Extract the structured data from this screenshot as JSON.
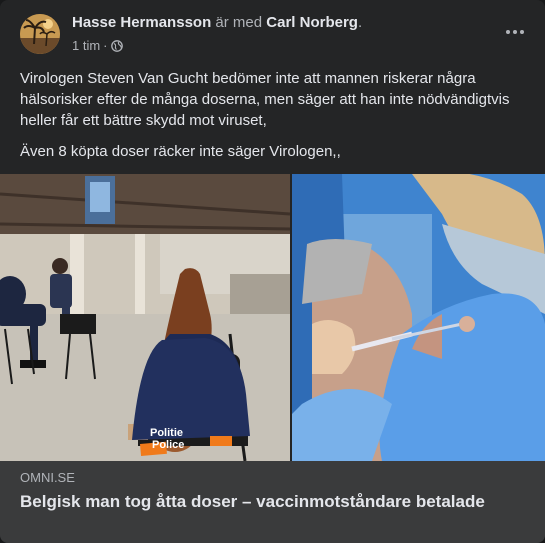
{
  "post": {
    "author": "Hasse Hermansson",
    "with_text": "är med",
    "tagged": "Carl Norberg",
    "tagged_suffix": ".",
    "time": "1 tim",
    "separator": "·",
    "privacy_icon": "globe-icon",
    "menu_icon": "more-options-icon"
  },
  "content": {
    "paragraph1": "Virologen Steven Van Gucht bedömer inte att mannen riskerar några hälsorisker efter de många doserna, men säger att han inte nödvändigtvis heller får ett bättre skydd mot viruset,",
    "paragraph2": "Även 8 köpta doser räcker inte säger Virologen,,"
  },
  "photo": {
    "vest_text_line1": "Politie",
    "vest_text_line2": "Police"
  },
  "link": {
    "domain": "OMNI.SE",
    "title": "Belgisk man tog åtta doser – vaccinmotståndare betalade"
  },
  "colors": {
    "card_bg": "#242526",
    "footer_bg": "#3a3b3c",
    "text_primary": "#e4e6eb",
    "text_secondary": "#b0b3b8"
  }
}
